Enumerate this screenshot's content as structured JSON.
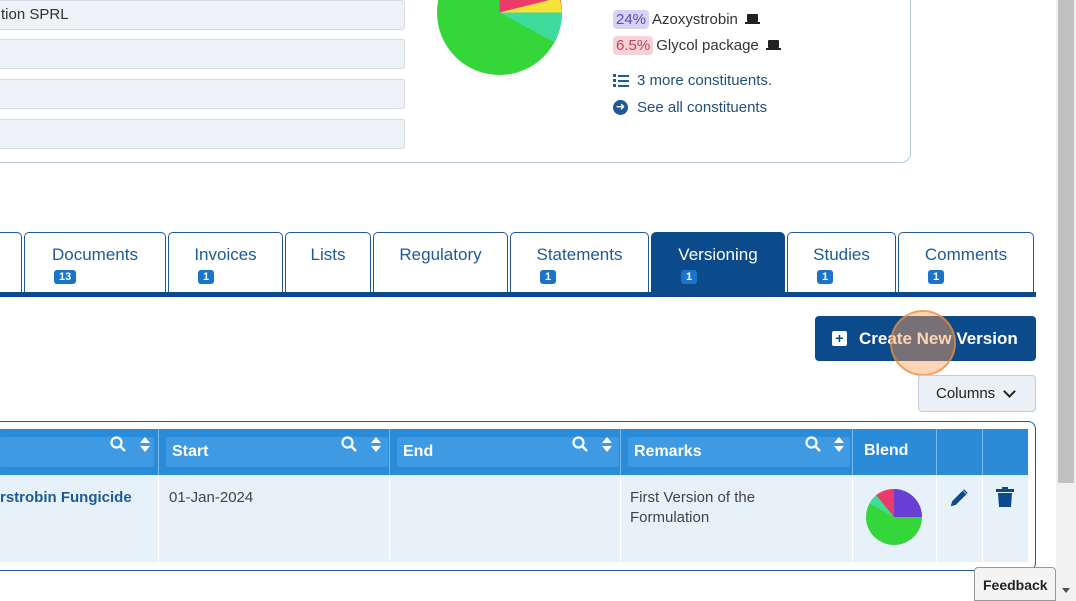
{
  "form": {
    "field1_value": "tion SPRL",
    "field2_value": "",
    "field3_value": "",
    "field4_value": ""
  },
  "composition": {
    "constituents": [
      {
        "percent": "24%",
        "name": "Azoxystrobin",
        "color": "#d9d2f5",
        "icon": "laptop-icon"
      },
      {
        "percent": "6.5%",
        "name": "Glycol package",
        "color": "#f7d0d8",
        "icon": "laptop-icon"
      }
    ],
    "more_label": "3 more constituents.",
    "see_all_label": "See all constituents",
    "pie_colors": [
      "#34d63a",
      "#3ddc9b",
      "#ee3a6a",
      "#f5e23a"
    ]
  },
  "tabs": [
    {
      "label": "Documents",
      "badge": "13"
    },
    {
      "label": "Invoices",
      "badge": "1"
    },
    {
      "label": "Lists",
      "badge": ""
    },
    {
      "label": "Regulatory",
      "badge": ""
    },
    {
      "label": "Statements",
      "badge": "1"
    },
    {
      "label": "Versioning",
      "badge": "1",
      "active": true
    },
    {
      "label": "Studies",
      "badge": "1"
    },
    {
      "label": "Comments",
      "badge": "1"
    }
  ],
  "toolbar": {
    "create_label": "Create New Version",
    "columns_label": "Columns"
  },
  "table": {
    "headers": {
      "start": "Start",
      "end": "End",
      "remarks": "Remarks",
      "blend": "Blend"
    },
    "rows": [
      {
        "name": "rstrobin Fungicide",
        "start": "01-Jan-2024",
        "end": "",
        "remarks_line1": "First Version of the",
        "remarks_line2": "Formulation"
      }
    ]
  },
  "feedback_label": "Feedback",
  "colors": {
    "primary": "#0b4a8b",
    "header": "#2a8bd8",
    "row_bg": "#e6f1fa"
  }
}
